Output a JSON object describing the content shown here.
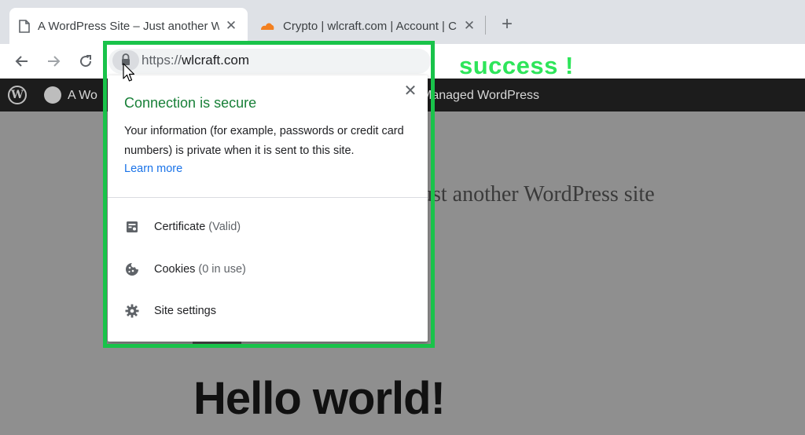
{
  "browser": {
    "tabs": [
      {
        "title": "A WordPress Site – Just another W",
        "icon": "page-icon",
        "active": true
      },
      {
        "title": "Crypto | wlcraft.com | Account | C",
        "icon": "cloudflare-icon",
        "active": false
      }
    ],
    "new_tab": "+",
    "close_glyph": "✕",
    "url": {
      "scheme": "https://",
      "host": "wlcraft.com"
    }
  },
  "page": {
    "admin_bar": {
      "site_name": "A Wo",
      "managed_label": "Managed WordPress"
    },
    "tagline": "ust another WordPress site",
    "headline": "Hello world!"
  },
  "popup": {
    "title": "Connection is secure",
    "description": "Your information (for example, passwords or credit card numbers) is private when it is sent to this site.",
    "learn_more": "Learn more",
    "close": "✕",
    "rows": [
      {
        "icon": "certificate-icon",
        "label": "Certificate",
        "sub": "(Valid)"
      },
      {
        "icon": "cookie-icon",
        "label": "Cookies",
        "sub": "(0 in use)"
      },
      {
        "icon": "gear-icon",
        "label": "Site settings",
        "sub": ""
      }
    ]
  },
  "annotation": {
    "text": "success !"
  },
  "colors": {
    "secure_green": "#188038",
    "highlight": "#19c34a",
    "link": "#1a73e8"
  }
}
